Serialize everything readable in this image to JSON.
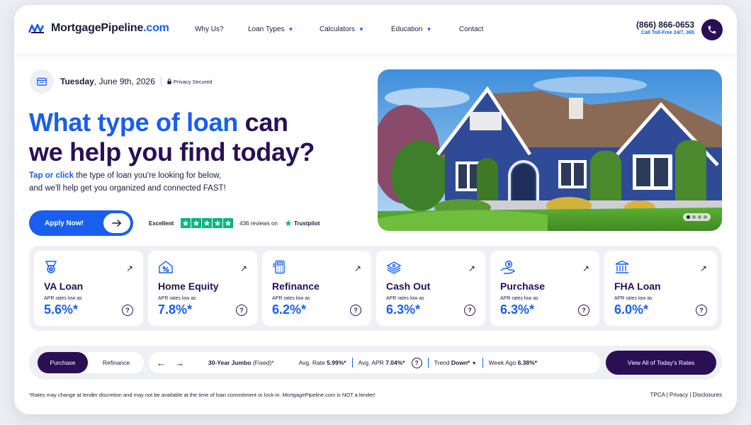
{
  "header": {
    "logo_brand": "MortgagePipeline",
    "logo_tld": ".com",
    "nav": [
      {
        "label": "Why Us?",
        "dropdown": false
      },
      {
        "label": "Loan Types",
        "dropdown": true
      },
      {
        "label": "Calculators",
        "dropdown": true
      },
      {
        "label": "Education",
        "dropdown": true
      },
      {
        "label": "Contact",
        "dropdown": false
      }
    ],
    "phone_number": "(866) 866-0653",
    "phone_sub": "Call Toll-Free 24/7, 365",
    "phone_icon": "phone-icon"
  },
  "hero": {
    "date_day": "Tuesday",
    "date_rest": ", June 9th, 2026",
    "privacy": "Privacy Secured",
    "headline_blue": "What type of loan",
    "headline_dark_1": " can",
    "headline_dark_2": "we help you find today?",
    "sub_accent": "Tap or click",
    "sub_rest_1": " the type of loan you're looking for below,",
    "sub_line_2": "and we'll help get you organized and connected FAST!",
    "apply_label": "Apply Now!",
    "trust_rating": "Excellent",
    "trust_reviews": "436 reviews on",
    "trust_brand": "Trustpilot",
    "trust_stars": 5,
    "image_icon": "house-photo"
  },
  "loans": [
    {
      "name": "VA Loan",
      "apr_label": "APR rates low as",
      "rate": "5.6%*",
      "icon": "military-medal-icon"
    },
    {
      "name": "Home Equity",
      "apr_label": "APR rates low as",
      "rate": "7.8%*",
      "icon": "house-percent-icon"
    },
    {
      "name": "Refinance",
      "apr_label": "APR rates low as",
      "rate": "6.2%*",
      "icon": "calculator-icon"
    },
    {
      "name": "Cash Out",
      "apr_label": "APR rates low as",
      "rate": "6.3%*",
      "icon": "money-stack-icon"
    },
    {
      "name": "Purchase",
      "apr_label": "APR rates low as",
      "rate": "6.3%*",
      "icon": "hand-dollar-icon"
    },
    {
      "name": "FHA Loan",
      "apr_label": "APR rates low as",
      "rate": "6.0%*",
      "icon": "bank-icon"
    }
  ],
  "ratebar": {
    "tab_active": "Purchase",
    "tab_inactive": "Refinance",
    "product": "30-Year Jumbo",
    "product_suffix": " (Fixed)*",
    "avg_rate_label": "Avg. Rate",
    "avg_rate_value": "5.99%*",
    "avg_apr_label": "Avg. APR",
    "avg_apr_value": "7.04%*",
    "trend_label": "Trend",
    "trend_value": "Down*",
    "week_ago_label": "Week Ago",
    "week_ago_value": "6.38%*",
    "view_all": "View All of Today's Rates"
  },
  "footer": {
    "disclaimer": "*Rates may change at lender discretion and may not be available at the time of loan commitment or lock-in. MortgagePipeline.com is NOT a lender!",
    "links": "TPCA | Privacy | Disclosures"
  },
  "colors": {
    "brand_blue": "#1a5ef0",
    "brand_purple": "#2a0f55",
    "trustpilot_green": "#00b67a"
  }
}
